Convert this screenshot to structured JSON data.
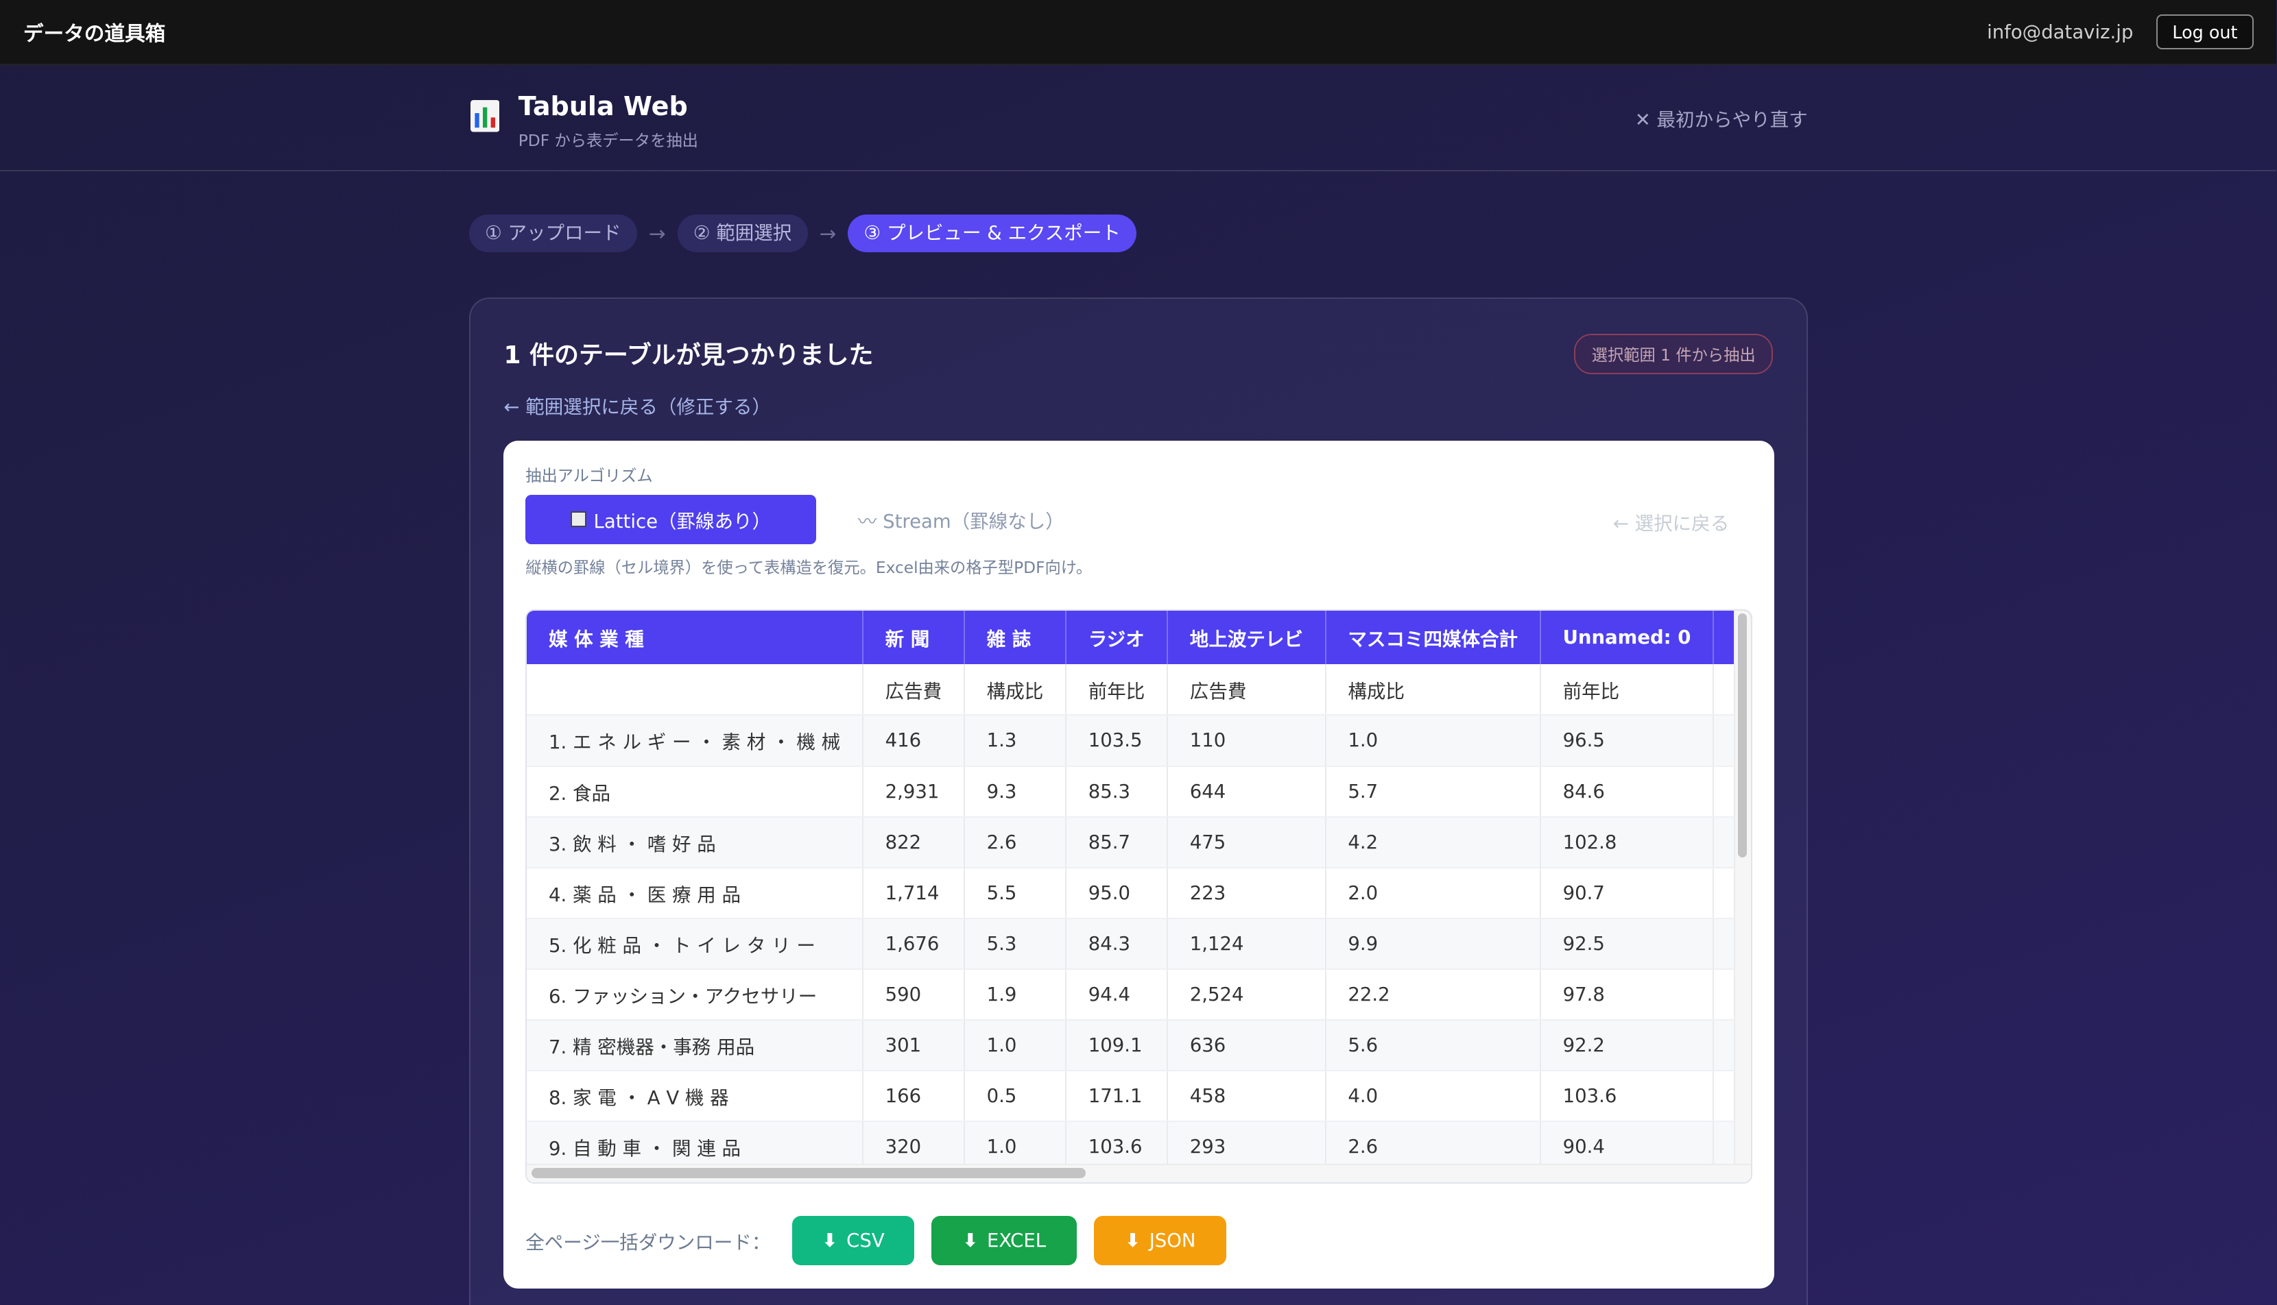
{
  "topbar": {
    "brand": "データの道具箱",
    "email": "info@dataviz.jp",
    "logout": "Log out"
  },
  "header": {
    "icon": "bar-chart-icon",
    "title": "Tabula Web",
    "subtitle": "PDF から表データを抽出",
    "restart": "✕ 最初からやり直す"
  },
  "steps": [
    {
      "label": "① アップロード"
    },
    {
      "label": "② 範囲選択"
    },
    {
      "label": "③ プレビュー & エクスポート"
    }
  ],
  "step_arrow": "→",
  "panel": {
    "title": "1 件のテーブルが見つかりました",
    "badge": "選択範囲 1 件から抽出",
    "back_link": "← 範囲選択に戻る（修正する）"
  },
  "algorithm": {
    "label": "抽出アルゴリズム",
    "lattice": "Lattice（罫線あり）",
    "stream": "〰 Stream（罫線なし）",
    "back_select": "← 選択に戻る",
    "description": "縦横の罫線（セル境界）を使って表構造を復元。Excel由来の格子型PDF向け。"
  },
  "table": {
    "headers": [
      "媒 体 業 種",
      "新 聞",
      "雑 誌",
      "ラジオ",
      "地上波テレビ",
      "マスコミ四媒体合計",
      "Unnamed: 0",
      ""
    ],
    "rows": [
      [
        "",
        "広告費",
        "構成比",
        "前年比",
        "広告費",
        "構成比",
        "前年比",
        ""
      ],
      [
        "1. エ ネ ル ギ ー ・ 素 材 ・ 機 械",
        "416",
        "1.3",
        "103.5",
        "110",
        "1.0",
        "96.5",
        ""
      ],
      [
        "2. 食品",
        "2,931",
        "9.3",
        "85.3",
        "644",
        "5.7",
        "84.6",
        ""
      ],
      [
        "3. 飲 料 ・ 嗜 好 品",
        "822",
        "2.6",
        "85.7",
        "475",
        "4.2",
        "102.8",
        ""
      ],
      [
        "4. 薬 品 ・ 医 療 用 品",
        "1,714",
        "5.5",
        "95.0",
        "223",
        "2.0",
        "90.7",
        ""
      ],
      [
        "5. 化 粧 品 ・ ト イ レ タ リ ー",
        "1,676",
        "5.3",
        "84.3",
        "1,124",
        "9.9",
        "92.5",
        ""
      ],
      [
        "6. ファッション・アクセサリー",
        "590",
        "1.9",
        "94.4",
        "2,524",
        "22.2",
        "97.8",
        ""
      ],
      [
        "7. 精 密機器・事務 用品",
        "301",
        "1.0",
        "109.1",
        "636",
        "5.6",
        "92.2",
        ""
      ],
      [
        "8. 家 電 ・ A V 機 器",
        "166",
        "0.5",
        "171.1",
        "458",
        "4.0",
        "103.6",
        ""
      ],
      [
        "9. 自 動 車 ・ 関 連 品",
        "320",
        "1.0",
        "103.6",
        "293",
        "2.6",
        "90.4",
        ""
      ]
    ]
  },
  "downloads": {
    "label": "全ページ一括ダウンロード：",
    "arrow": "⬇",
    "csv": "CSV",
    "excel": "EXCEL",
    "json": "JSON"
  }
}
